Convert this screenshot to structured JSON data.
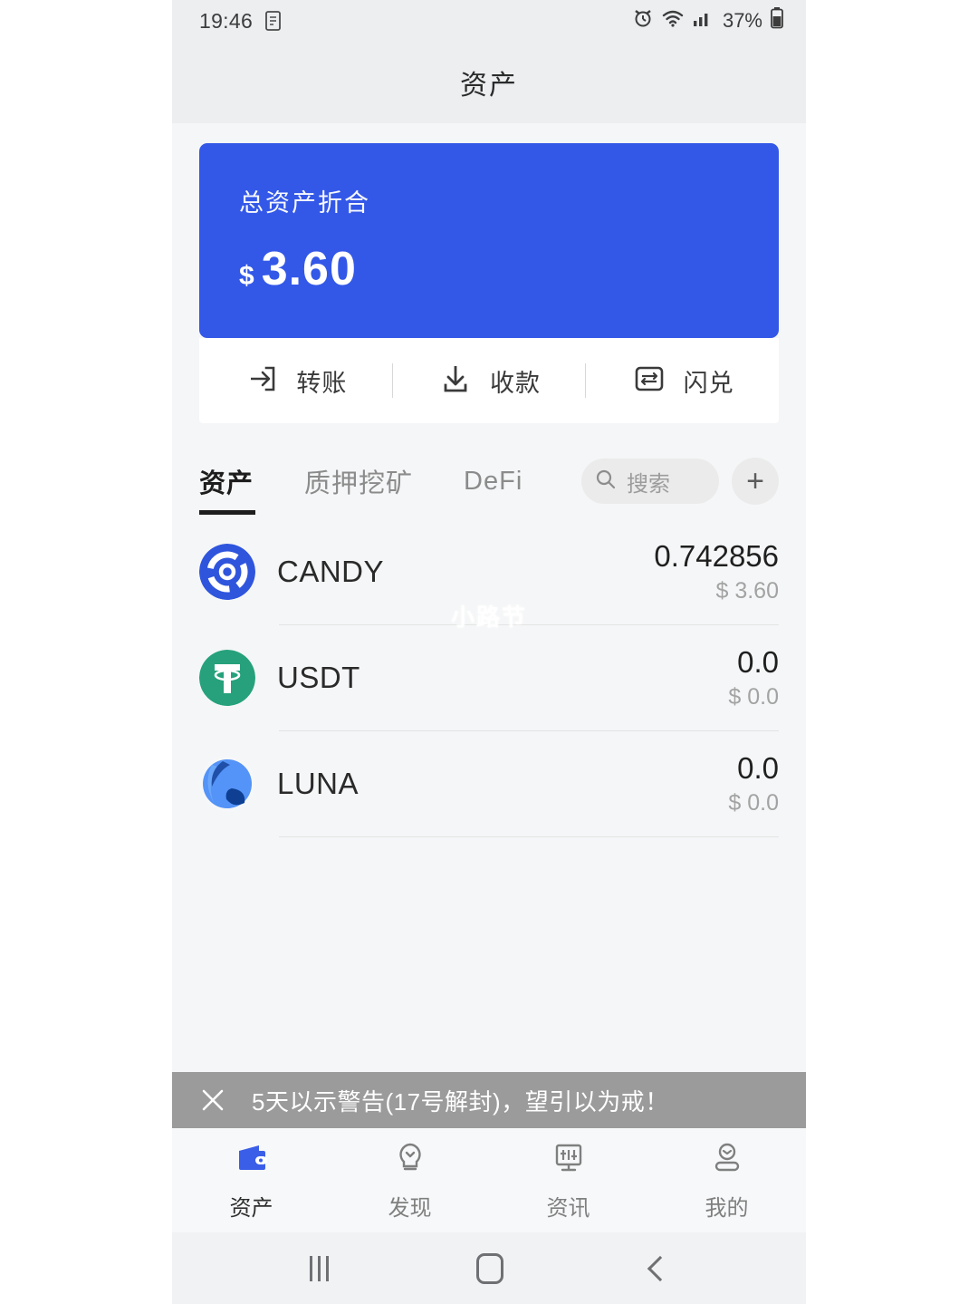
{
  "status_bar": {
    "time": "19:46",
    "doc_icon": "document-icon",
    "alarm_icon": "alarm-icon",
    "wifi_icon": "wifi-icon",
    "signal_icon": "signal-bars-icon",
    "battery_percent": "37%",
    "battery_icon": "battery-icon"
  },
  "header": {
    "title": "资产"
  },
  "balance_card": {
    "label": "总资产折合",
    "currency_symbol": "$",
    "amount": "3.60",
    "background_color": "#3358e8"
  },
  "actions": [
    {
      "label": "转账",
      "icon": "transfer-out-icon"
    },
    {
      "label": "收款",
      "icon": "download-receive-icon"
    },
    {
      "label": "闪兑",
      "icon": "swap-exchange-icon"
    }
  ],
  "tabs": [
    {
      "label": "资产",
      "active": true
    },
    {
      "label": "质押挖矿",
      "active": false
    },
    {
      "label": "DeFi",
      "active": false
    }
  ],
  "search": {
    "placeholder": "搜索",
    "icon": "search-icon"
  },
  "add_button": {
    "label": "+",
    "icon": "plus-icon"
  },
  "assets": [
    {
      "symbol": "CANDY",
      "amount": "0.742856",
      "fiat": "$ 3.60",
      "icon": "candy-token-icon",
      "color": "#2f55dd"
    },
    {
      "symbol": "USDT",
      "amount": "0.0",
      "fiat": "$ 0.0",
      "icon": "usdt-token-icon",
      "color": "#26a17b"
    },
    {
      "symbol": "LUNA",
      "amount": "0.0",
      "fiat": "$ 0.0",
      "icon": "luna-token-icon",
      "color": "#5493f7"
    }
  ],
  "watermark": {
    "text": "小路节"
  },
  "banner": {
    "close_icon": "close-x-icon",
    "message": "5天以示警告(17号解封)，望引以为戒！",
    "background_color": "#9b9b9b"
  },
  "bottom_nav": [
    {
      "label": "资产",
      "icon": "wallet-icon",
      "active": true
    },
    {
      "label": "发现",
      "icon": "lightbulb-icon",
      "active": false
    },
    {
      "label": "资讯",
      "icon": "monitor-chart-icon",
      "active": false
    },
    {
      "label": "我的",
      "icon": "person-icon",
      "active": false
    }
  ],
  "android_nav": [
    {
      "icon": "recents-icon"
    },
    {
      "icon": "home-icon"
    },
    {
      "icon": "back-icon"
    }
  ]
}
